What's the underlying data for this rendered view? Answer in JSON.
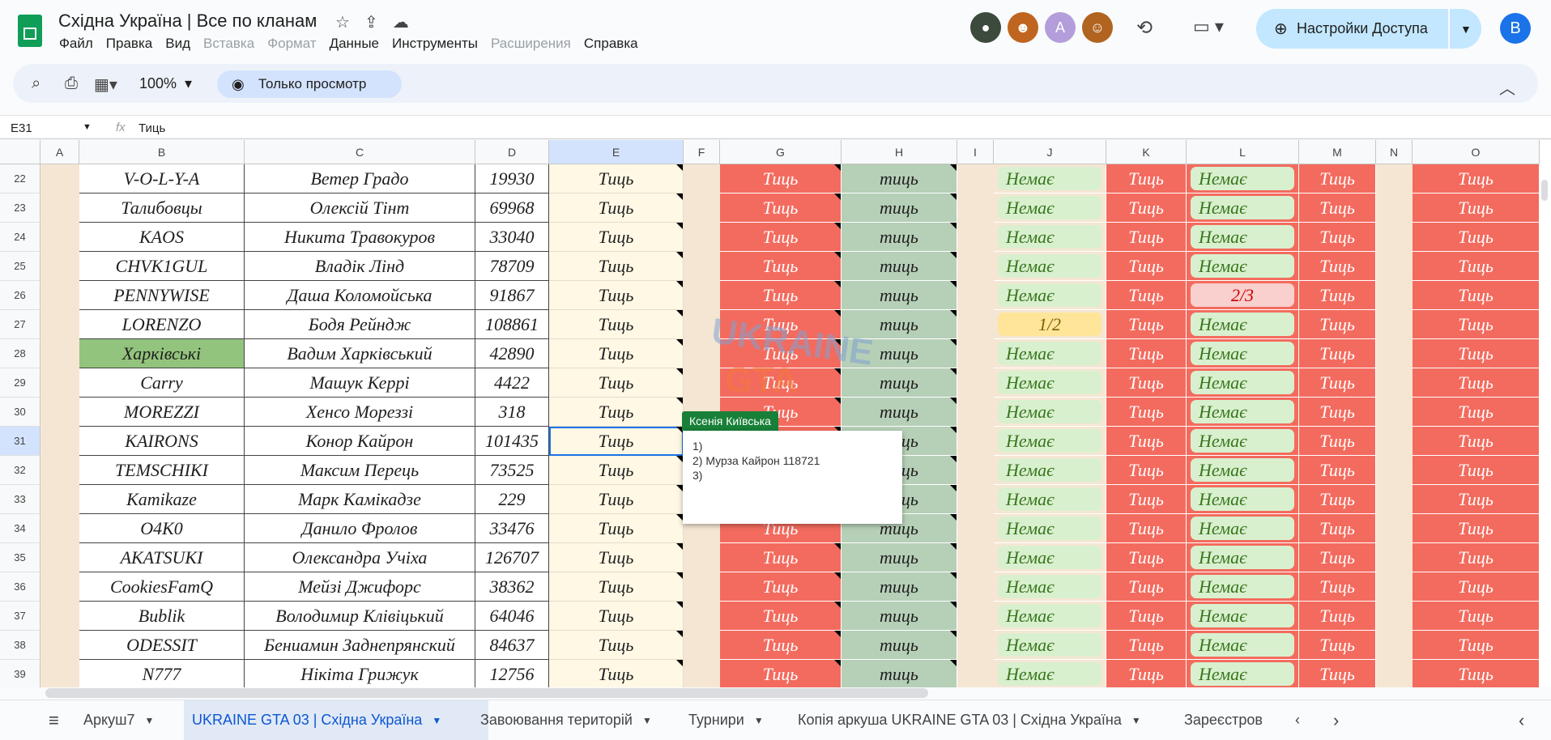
{
  "doc_title": "Східна Україна | Все по кланам",
  "menu": [
    "Файл",
    "Правка",
    "Вид",
    "Вставка",
    "Формат",
    "Данные",
    "Инструменты",
    "Расширения",
    "Справка"
  ],
  "menu_disabled": [
    3,
    4,
    7
  ],
  "share_label": "Настройки Доступа",
  "user_initial": "B",
  "avatar_letter": "A",
  "zoom": "100%",
  "view_only_label": "Только просмотр",
  "formula_bar": {
    "cell_ref": "E31",
    "fx": "fx",
    "value": "Тиць"
  },
  "columns": [
    "A",
    "B",
    "C",
    "D",
    "E",
    "F",
    "G",
    "H",
    "I",
    "J",
    "K",
    "L",
    "M",
    "N",
    "O"
  ],
  "rows": [
    {
      "n": "22",
      "b": "V-O-L-Y-A",
      "c": "Ветер Градо",
      "d": "19930",
      "j": "Немає",
      "l": "Немає"
    },
    {
      "n": "23",
      "b": "Талибовцы",
      "c": "Олексій Тінт",
      "d": "69968",
      "j": "Немає",
      "l": "Немає"
    },
    {
      "n": "24",
      "b": "KAOS",
      "c": "Никита Травокуров",
      "d": "33040",
      "j": "Немає",
      "l": "Немає"
    },
    {
      "n": "25",
      "b": "CHVK1GUL",
      "c": "Владік Лінд",
      "d": "78709",
      "j": "Немає",
      "l": "Немає"
    },
    {
      "n": "26",
      "b": "PENNYWISE",
      "c": "Даша Коломойська",
      "d": "91867",
      "j": "Немає",
      "l": "2/3"
    },
    {
      "n": "27",
      "b": "LORENZO",
      "c": "Бодя Рейндж",
      "d": "108861",
      "j": "1/2",
      "l": "Немає"
    },
    {
      "n": "28",
      "b": "Харківські",
      "c": "Вадим Харківський",
      "d": "42890",
      "j": "Немає",
      "l": "Немає"
    },
    {
      "n": "29",
      "b": "Carry",
      "c": "Машук Керрі",
      "d": "4422",
      "j": "Немає",
      "l": "Немає"
    },
    {
      "n": "30",
      "b": "MOREZZI",
      "c": "Хенсо Мореззі",
      "d": "318",
      "j": "Немає",
      "l": "Немає"
    },
    {
      "n": "31",
      "b": "KAIRONS",
      "c": "Конор Кайрон",
      "d": "101435",
      "j": "Немає",
      "l": "Немає"
    },
    {
      "n": "32",
      "b": "TEMSCHIKI",
      "c": "Максим Перець",
      "d": "73525",
      "j": "Немає",
      "l": "Немає"
    },
    {
      "n": "33",
      "b": "Kamikaze",
      "c": "Марк Камікадзе",
      "d": "229",
      "j": "Немає",
      "l": "Немає"
    },
    {
      "n": "34",
      "b": "O4K0",
      "c": "Данило Фролов",
      "d": "33476",
      "j": "Немає",
      "l": "Немає"
    },
    {
      "n": "35",
      "b": "AKATSUKI",
      "c": "Олександра Учіха",
      "d": "126707",
      "j": "Немає",
      "l": "Немає"
    },
    {
      "n": "36",
      "b": "CookiesFamQ",
      "c": "Мейзі Джифорс",
      "d": "38362",
      "j": "Немає",
      "l": "Немає"
    },
    {
      "n": "37",
      "b": "Bublik",
      "c": "Володимир Клівіцький",
      "d": "64046",
      "j": "Немає",
      "l": "Немає"
    },
    {
      "n": "38",
      "b": "ODESSIT",
      "c": "Бениамин Заднепрянский",
      "d": "84637",
      "j": "Немає",
      "l": "Немає"
    },
    {
      "n": "39",
      "b": "N777",
      "c": "Нікіта Грижук",
      "d": "12756",
      "j": "Немає",
      "l": "Немає"
    }
  ],
  "tyc": "Тиць",
  "tyc_lower": "тиць",
  "highlight_row": "28",
  "selected_row": "31",
  "comment": {
    "author": "Ксенія Київська",
    "lines": [
      "1)",
      "2)  Мурза Кайрон 118721",
      "3)"
    ]
  },
  "watermark": {
    "line1": "UKRAINE",
    "line2": "GTA"
  },
  "sheet_tabs": [
    "Аркуш7",
    "UKRAINE GTA 03 | Східна Україна",
    "Завоювання територій",
    "Турнири",
    "Копія аркуша UKRAINE GTA 03 | Східна Україна",
    "Зареєстров"
  ],
  "active_tab": 1,
  "colors": {
    "red": "#f36b5e",
    "sage": "#b6cfb7",
    "cream": "#fff8e5",
    "beige": "#f5e6d3",
    "green_pill": "#d9f0cf",
    "accent": "#0b57d0"
  }
}
